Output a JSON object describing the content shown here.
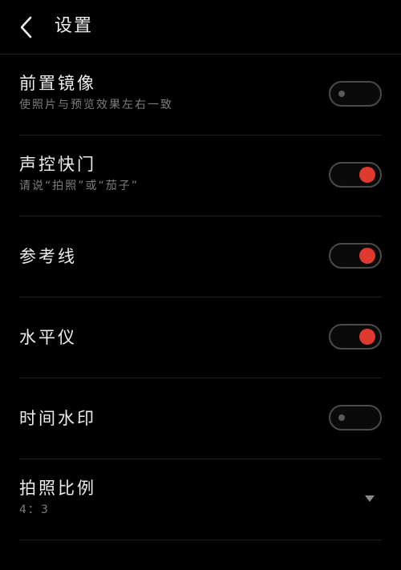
{
  "header": {
    "title": "设置",
    "back_icon": "chevron-left-icon"
  },
  "colors": {
    "background": "#000000",
    "accent_on": "#e0392f",
    "toggle_border": "#4a4a4a",
    "subtitle": "#7d7d7d"
  },
  "settings": {
    "front_mirror": {
      "title": "前置镜像",
      "subtitle": "使照片与预览效果左右一致",
      "state": "off"
    },
    "voice_shutter": {
      "title": "声控快门",
      "subtitle": "请说“拍照”或“茄子”",
      "state": "on"
    },
    "grid_lines": {
      "title": "参考线",
      "state": "on"
    },
    "level": {
      "title": "水平仪",
      "state": "on"
    },
    "time_watermark": {
      "title": "时间水印",
      "state": "off"
    },
    "aspect_ratio": {
      "title": "拍照比例",
      "value": "4：3",
      "icon": "dropdown-triangle-icon"
    }
  }
}
